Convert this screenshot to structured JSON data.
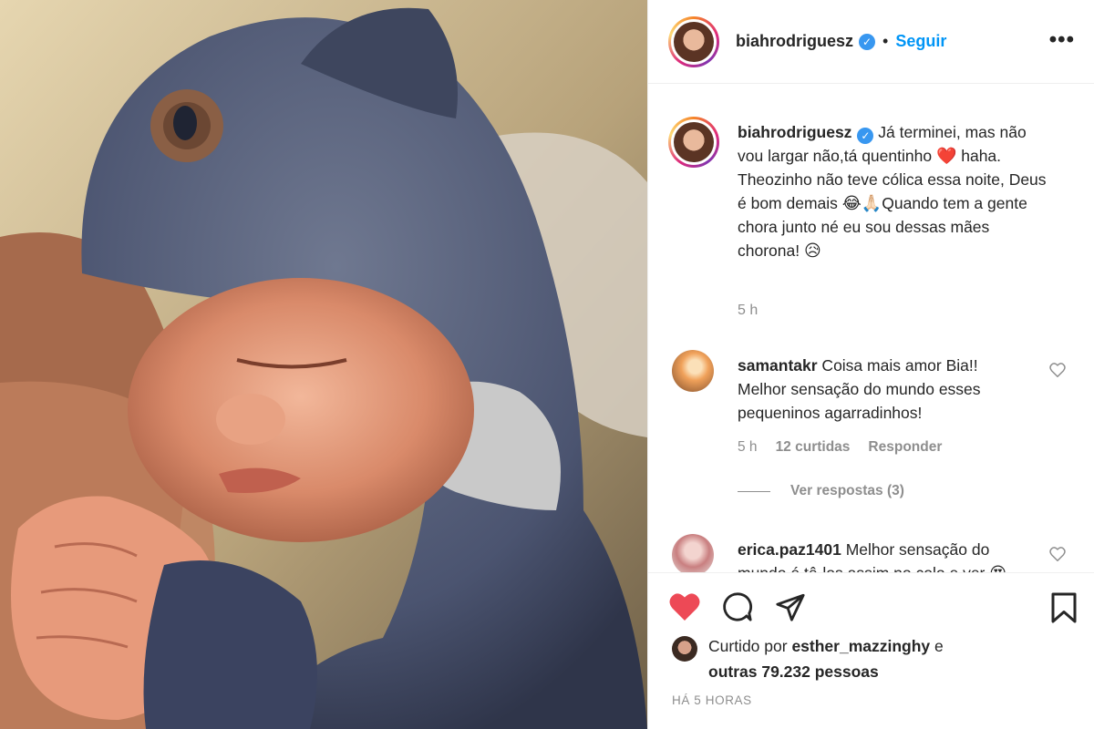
{
  "post": {
    "username": "biahrodriguesz",
    "verified_mark": "✓",
    "separator": "•",
    "follow_label": "Seguir",
    "more_label": "•••"
  },
  "caption": {
    "username": "biahrodriguesz",
    "line1": " Já terminei, mas não vou largar não,tá quentinho ",
    "heart": "❤️",
    "line1b": " haha.",
    "line2": "Theozinho não teve cólica essa noite, Deus é bom demais ",
    "emoji_laugh": "😂",
    "emoji_pray": "🙏🏻",
    "line2b": "Quando tem a gente chora junto né eu sou dessas mães chorona! ",
    "emoji_sad": "😥",
    "time": "5 h"
  },
  "comments": [
    {
      "username": "samantakr",
      "text": " Coisa mais amor Bia!! Melhor sensação do mundo esses pequeninos agarradinhos!",
      "time": "5 h",
      "likes": "12 curtidas",
      "reply_label": "Responder",
      "view_replies": "Ver respostas (3)"
    },
    {
      "username": "erica.paz1401",
      "text": " Melhor sensação do mundo é tê-los assim no colo e ver ",
      "emoji": "😍"
    }
  ],
  "likes": {
    "prefix": "Curtido por ",
    "liker": "esther_mazzinghy",
    "connector": " e",
    "others": "outras 79.232 pessoas"
  },
  "posted_ago": "HÁ 5 HORAS",
  "colors": {
    "accent_blue": "#0095f6",
    "like_red": "#ed4956",
    "muted": "#8e8e8e"
  },
  "icons": [
    "heart-icon",
    "comment-icon",
    "share-icon",
    "bookmark-icon",
    "like-outline-icon",
    "more-icon"
  ]
}
